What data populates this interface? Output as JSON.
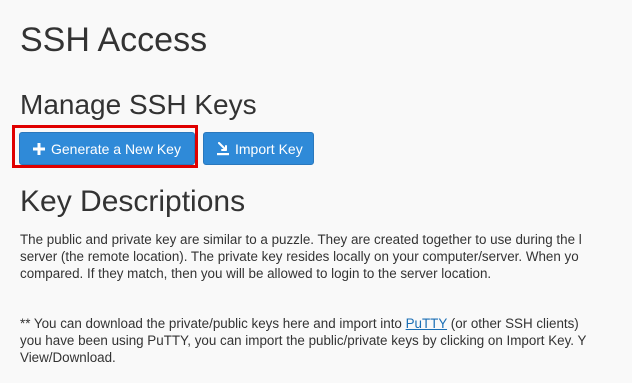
{
  "page": {
    "title": "SSH Access"
  },
  "manage": {
    "title": "Manage SSH Keys",
    "generate_button_label": "Generate a New Key",
    "import_button_label": "Import Key"
  },
  "descriptions": {
    "title": "Key Descriptions",
    "paragraph1": {
      "line1": "The public and private key are similar to a puzzle. They are created together to use during the l",
      "line2": "server (the remote location). The private key resides locally on your computer/server. When yo",
      "line3": "compared. If they match, then you will be allowed to login to the server location."
    },
    "paragraph2": {
      "line1_before_link": "** You can download the private/public keys here and import into ",
      "link_text": "PuTTY",
      "line1_after_link": " (or other SSH clients)",
      "line2": "you have been using PuTTY, you can import the public/private keys by clicking on Import Key. Y",
      "line3": "View/Download."
    }
  },
  "icons": {
    "generate": "plus-icon",
    "import": "import-icon"
  },
  "colors": {
    "button_bg": "#2f8ad8",
    "highlight": "#e00000",
    "link": "#1a6eb5"
  }
}
